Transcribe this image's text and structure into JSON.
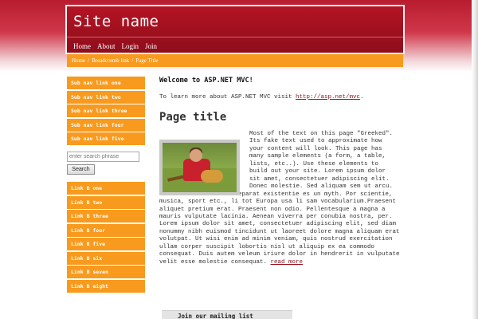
{
  "header": {
    "site_name": "Site name",
    "nav": [
      "Home",
      "About",
      "Login",
      "Join"
    ]
  },
  "breadcrumb": {
    "items": [
      "Home",
      "Breadcrumb link",
      "Page Title"
    ],
    "separator": "/"
  },
  "sidebar": {
    "sub_nav": [
      "Sub nav link one",
      "Sub nav link two",
      "Sub nav link three",
      "Sub nav link four",
      "Sub nav link five"
    ],
    "search": {
      "placeholder": "enter search phrase",
      "button_label": "Search"
    },
    "links_b": [
      "Link B one",
      "Link B two",
      "Link B three",
      "Link B four",
      "Link B five",
      "Link B six",
      "Link B seven",
      "Link B eight"
    ]
  },
  "main": {
    "welcome": "Welcome to ASP.NET MVC!",
    "intro": "To learn more about ASP.NET MVC visit",
    "intro_link": "http://asp.net/mvc",
    "intro_end": ".",
    "page_title": "Page title",
    "body": "Most of the text on this page \"Greeked\". Its fake text used to approximate how your content will look. This page has many sample elements (a form, a table, lists, etc..). Use these elements to build out your site. Lorem ipsum dolor sit amet, consectetuer adipiscing elit. Donec molestie. Sed aliquam sem ut arcu. Del sam familie. Lor separat existentie es un myth. Por scientie, musica, sport etc., li tot Europa usa li sam vocabularium.Praesent aliquet pretium erat. Praesent non odio. Pellentesque a magna a mauris vulputate lacinia. Aenean viverra per conubia nostra, per. Lorem ipsum dolor sit amet, consectetuer adipiscing elit, sed diam nonummy nibh euismod tincidunt ut laoreet dolore magna aliquam erat volutpat. Ut wisi enim ad minim veniam, quis nostrud exercitation ullam corper suscipit lobortis nisl ut aliquip ex ea commodo consequat. Duis autem veleum iriure dolor in hendrerit in vulputate velit esse molestie consequat.",
    "read_more": "read more",
    "mailing_list": "Join our mailing list"
  },
  "colors": {
    "header_red": "#b51424",
    "accent_orange": "#f79a1e",
    "link_red": "#8e0d1b"
  }
}
